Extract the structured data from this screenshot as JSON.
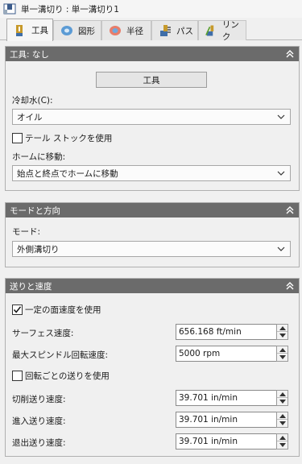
{
  "title": "単一溝切り : 単一溝切り1",
  "tabs": [
    {
      "label": "工具",
      "icon": "tool-icon"
    },
    {
      "label": "図形",
      "icon": "geometry-icon"
    },
    {
      "label": "半径",
      "icon": "radii-icon"
    },
    {
      "label": "パス",
      "icon": "passes-icon"
    },
    {
      "label": "リンク",
      "icon": "linking-icon"
    }
  ],
  "tool_panel": {
    "header": "工具: なし",
    "tool_button": "工具",
    "coolant_label": "冷却水(C):",
    "coolant_value": "オイル",
    "tailstock_label": "テール ストックを使用",
    "tailstock_checked": false,
    "home_label": "ホームに移動:",
    "home_value": "始点と終点でホームに移動"
  },
  "mode_panel": {
    "header": "モードと方向",
    "mode_label": "モード:",
    "mode_value": "外側溝切り"
  },
  "feeds_panel": {
    "header": "送りと速度",
    "css_label": "一定の面速度を使用",
    "css_checked": true,
    "surface_speed_label": "サーフェス速度:",
    "surface_speed_value": "656.168 ft/min",
    "max_spindle_label": "最大スピンドル回転速度:",
    "max_spindle_value": "5000 rpm",
    "feed_per_rev_label": "回転ごとの送りを使用",
    "feed_per_rev_checked": false,
    "cutting_feed_label": "切削送り速度:",
    "cutting_feed_value": "39.701 in/min",
    "lead_in_label": "進入送り速度:",
    "lead_in_value": "39.701 in/min",
    "lead_out_label": "退出送り速度:",
    "lead_out_value": "39.701 in/min"
  }
}
